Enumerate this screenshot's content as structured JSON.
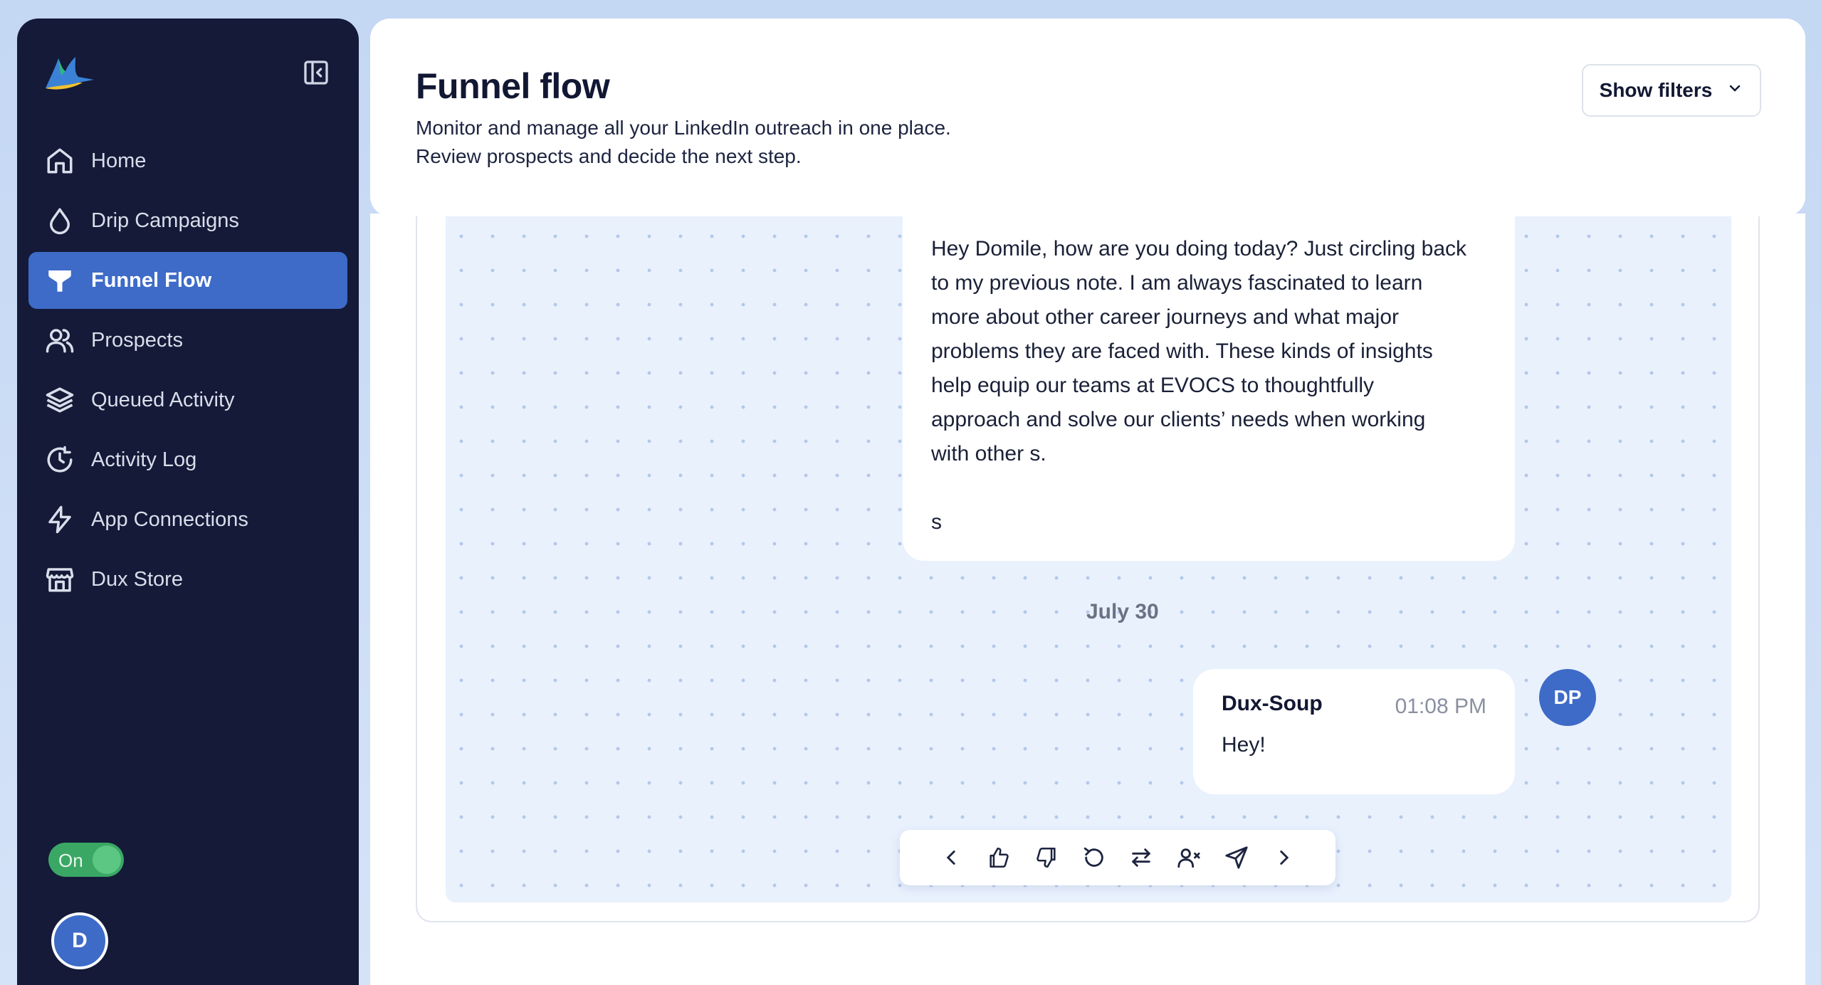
{
  "colors": {
    "sidebar_bg": "#141a38",
    "accent": "#3d6bc7",
    "toggle_on": "#3aa864",
    "chat_bg": "#e9f1fd"
  },
  "sidebar": {
    "logo_icon": "hummingbird-logo-icon",
    "collapse_icon": "collapse-sidebar-icon",
    "items": [
      {
        "label": "Home",
        "icon": "home-icon",
        "active": false
      },
      {
        "label": "Drip Campaigns",
        "icon": "drop-icon",
        "active": false
      },
      {
        "label": "Funnel Flow",
        "icon": "funnel-icon",
        "active": true
      },
      {
        "label": "Prospects",
        "icon": "users-icon",
        "active": false
      },
      {
        "label": "Queued Activity",
        "icon": "layers-icon",
        "active": false
      },
      {
        "label": "Activity Log",
        "icon": "history-icon",
        "active": false
      },
      {
        "label": "App Connections",
        "icon": "lightning-icon",
        "active": false
      },
      {
        "label": "Dux Store",
        "icon": "store-icon",
        "active": false
      }
    ],
    "toggle_label": "On",
    "user_initial": "D"
  },
  "header": {
    "title": "Funnel flow",
    "subtitle_line1": "Monitor and manage all your LinkedIn outreach in one place.",
    "subtitle_line2": "Review prospects and decide the next step.",
    "filters_label": "Show filters"
  },
  "conversation": {
    "long_message_lines": [
      "Hey Domile, how are you doing today? Just circling back",
      "to my previous note. I am always fascinated to learn",
      "more about other career journeys and what major",
      "problems they are faced with. These kinds of insights",
      "help equip our teams at EVOCS to thoughtfully",
      "approach and solve our clients’ needs when working",
      "with other s."
    ],
    "long_message_signature": "s",
    "date_label": "July 30",
    "reply": {
      "sender": "Dux-Soup",
      "time": "01:08 PM",
      "text": "Hey!",
      "avatar_initials": "DP"
    }
  },
  "toolbar": {
    "buttons": [
      "chevron-left-icon",
      "thumbs-up-icon",
      "thumbs-down-icon",
      "refresh-icon",
      "swap-icon",
      "remove-user-icon",
      "send-icon",
      "chevron-right-icon"
    ]
  }
}
